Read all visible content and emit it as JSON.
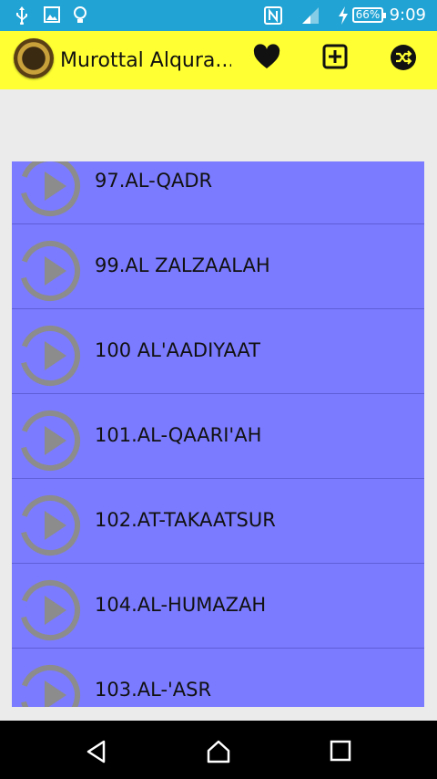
{
  "status_bar": {
    "battery": "66%",
    "time": "9:09",
    "icons": [
      "usb-icon",
      "image-icon",
      "lightbulb-icon",
      "nfc-icon",
      "signal-icon",
      "charging-icon"
    ]
  },
  "toolbar": {
    "title": "Murottal Alqura...",
    "icons": [
      "favorite-heart-icon",
      "add-box-icon",
      "shuffle-icon"
    ],
    "background": "#ffff33"
  },
  "list": {
    "background": "#7b7bff",
    "items": [
      {
        "label": "97.AL-QADR"
      },
      {
        "label": "99.AL ZALZAALAH"
      },
      {
        "label": "100 AL'AADIYAAT"
      },
      {
        "label": "101.AL-QAARI'AH"
      },
      {
        "label": "102.AT-TAKAATSUR"
      },
      {
        "label": "104.AL-HUMAZAH"
      },
      {
        "label": "103.AL-'ASR"
      }
    ]
  },
  "nav_bar": {
    "icons": [
      "back-icon",
      "home-icon",
      "recent-apps-icon"
    ]
  }
}
